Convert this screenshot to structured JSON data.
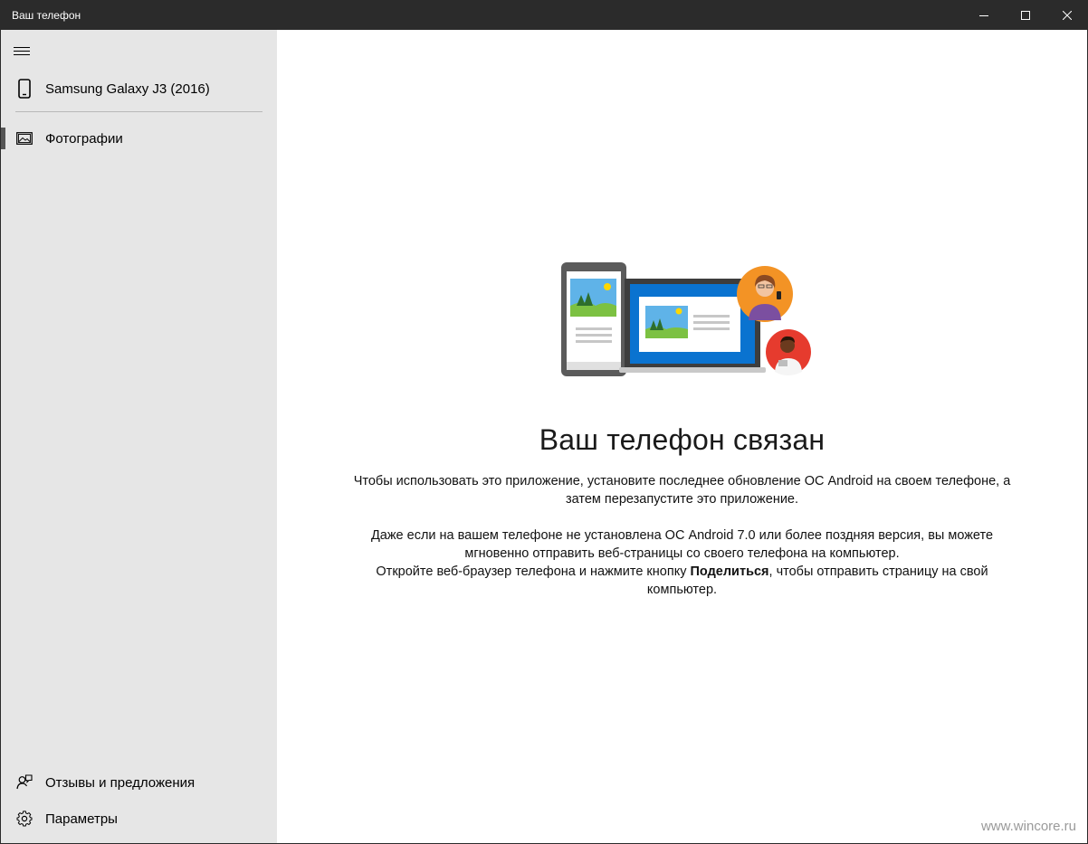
{
  "window": {
    "title": "Ваш телефон"
  },
  "sidebar": {
    "device_name": "Samsung Galaxy J3 (2016)",
    "items": [
      {
        "label": "Фотографии",
        "icon": "photos-icon",
        "active": true
      }
    ],
    "bottom_items": [
      {
        "label": "Отзывы и предложения",
        "icon": "feedback-icon"
      },
      {
        "label": "Параметры",
        "icon": "gear-icon"
      }
    ]
  },
  "main": {
    "heading": "Ваш телефон связан",
    "paragraph1": "Чтобы использовать это приложение, установите последнее обновление ОС Android на своем телефоне, а затем перезапустите это приложение.",
    "paragraph2": "Даже если на вашем телефоне не установлена ОС Android 7.0 или более поздняя версия, вы можете мгновенно отправить веб-страницы со своего телефона на компьютер.",
    "paragraph3_before": "Откройте веб-браузер телефона и нажмите кнопку ",
    "paragraph3_bold": "Поделиться",
    "paragraph3_after": ", чтобы отправить страницу на свой компьютер."
  },
  "watermark": "www.wincore.ru",
  "colors": {
    "titlebar": "#2b2b2b",
    "sidebar": "#e6e6e6",
    "accent_blue": "#0a73d0"
  }
}
